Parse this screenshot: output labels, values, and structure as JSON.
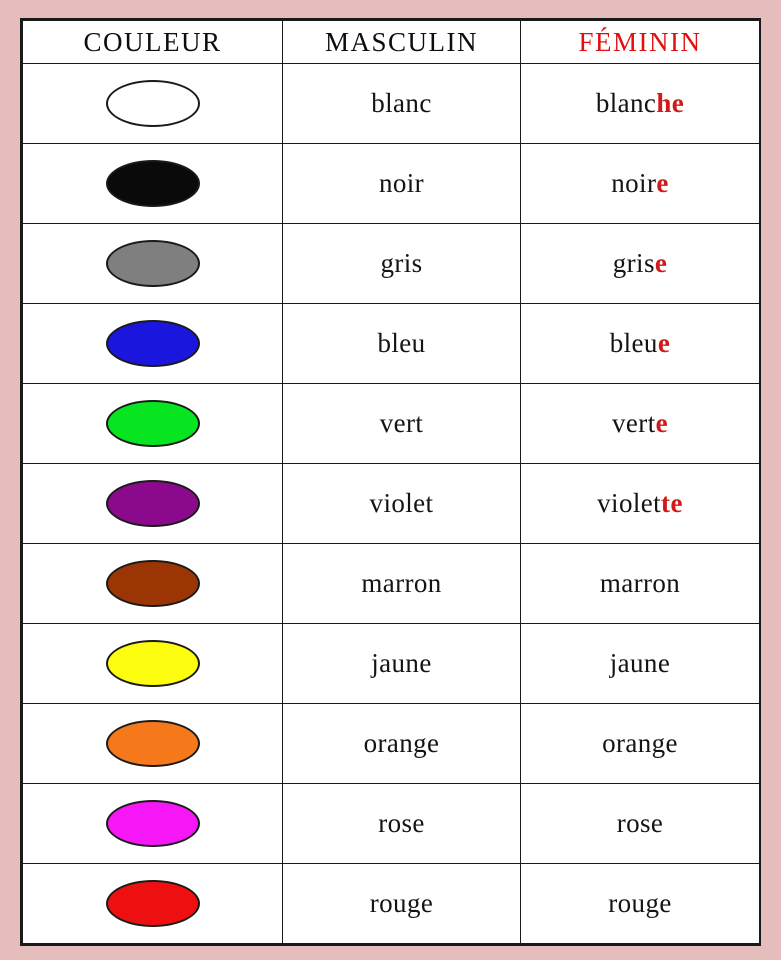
{
  "page": {
    "background_color": "#e5bdbd",
    "table_border_color": "#1a1a1a",
    "accent_red": "#d21818"
  },
  "table": {
    "headers": {
      "couleur": "COULEUR",
      "masculin": "MASCULIN",
      "feminin": "FÉMININ"
    },
    "header_background": "#dfdfdf",
    "feminin_header_color": "#e01010",
    "rows": [
      {
        "swatch_name": "oval-swatch-blanc",
        "color": "#ffffff",
        "masculin": "blanc",
        "feminin_stem": "blanc",
        "feminin_suffix": "he",
        "feminin_full": "blanche"
      },
      {
        "swatch_name": "oval-swatch-noir",
        "color": "#0a0a0a",
        "masculin": "noir",
        "feminin_stem": "noir",
        "feminin_suffix": "e",
        "feminin_full": "noire"
      },
      {
        "swatch_name": "oval-swatch-gris",
        "color": "#7f7f7f",
        "masculin": "gris",
        "feminin_stem": "gris",
        "feminin_suffix": "e",
        "feminin_full": "grise"
      },
      {
        "swatch_name": "oval-swatch-bleu",
        "color": "#1a16dd",
        "masculin": "bleu",
        "feminin_stem": "bleu",
        "feminin_suffix": "e",
        "feminin_full": "bleue"
      },
      {
        "swatch_name": "oval-swatch-vert",
        "color": "#06e520",
        "masculin": "vert",
        "feminin_stem": "vert",
        "feminin_suffix": "e",
        "feminin_full": "verte"
      },
      {
        "swatch_name": "oval-swatch-violet",
        "color": "#8b0a8b",
        "masculin": "violet",
        "feminin_stem": "violet",
        "feminin_suffix": "te",
        "feminin_full": "violette"
      },
      {
        "swatch_name": "oval-swatch-marron",
        "color": "#9c3504",
        "masculin": "marron",
        "feminin_stem": "marron",
        "feminin_suffix": "",
        "feminin_full": "marron"
      },
      {
        "swatch_name": "oval-swatch-jaune",
        "color": "#fdfd10",
        "masculin": "jaune",
        "feminin_stem": "jaune",
        "feminin_suffix": "",
        "feminin_full": "jaune"
      },
      {
        "swatch_name": "oval-swatch-orange",
        "color": "#f5781a",
        "masculin": "orange",
        "feminin_stem": "orange",
        "feminin_suffix": "",
        "feminin_full": "orange"
      },
      {
        "swatch_name": "oval-swatch-rose",
        "color": "#f517f5",
        "masculin": "rose",
        "feminin_stem": "rose",
        "feminin_suffix": "",
        "feminin_full": "rose"
      },
      {
        "swatch_name": "oval-swatch-rouge",
        "color": "#ee1010",
        "masculin": "rouge",
        "feminin_stem": "rouge",
        "feminin_suffix": "",
        "feminin_full": "rouge"
      }
    ]
  }
}
